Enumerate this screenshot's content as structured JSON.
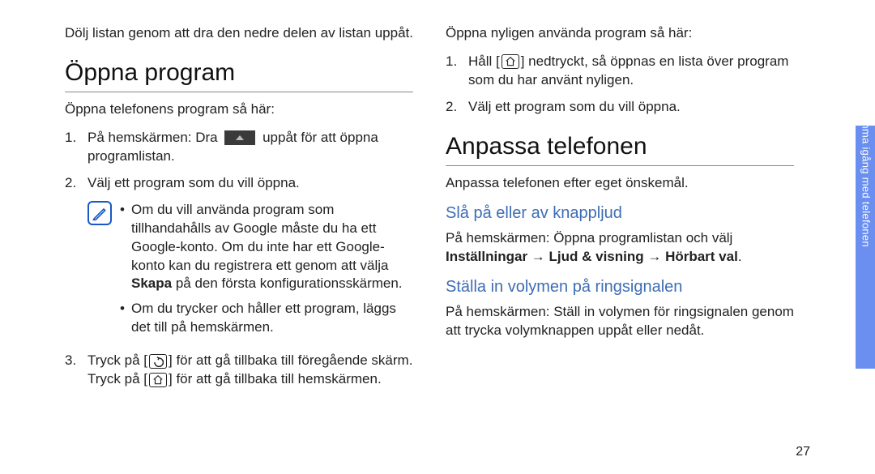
{
  "left": {
    "intro": "Dölj listan genom att dra den nedre delen av listan uppåt.",
    "h1": "Öppna program",
    "sub": "Öppna telefonens program så här:",
    "step1a": "På hemskärmen: Dra ",
    "step1b": " uppåt för att öppna programlistan.",
    "step2": "Välj ett program som du vill öppna.",
    "bullet1a": "Om du vill använda program som tillhandahålls av Google måste du ha ett Google-konto. Om du inte har ett Google-konto kan du registrera ett genom att välja ",
    "bullet1b": "Skapa",
    "bullet1c": " på den första konfigurationsskärmen.",
    "bullet2": "Om du trycker och håller ett program, läggs det till på hemskärmen.",
    "step3a": "Tryck på [",
    "step3b": "] för att gå tillbaka till föregående skärm. Tryck på [",
    "step3c": "] för att gå tillbaka till hemskärmen."
  },
  "right": {
    "intro": "Öppna nyligen använda program så här:",
    "step1a": "Håll [",
    "step1b": "] nedtryckt, så öppnas en lista över program som du har använt nyligen.",
    "step2": "Välj ett program som du vill öppna.",
    "h1": "Anpassa telefonen",
    "sub": "Anpassa telefonen efter eget önskemål.",
    "h2a": "Slå på eller av knappljud",
    "p2a": "På hemskärmen: Öppna programlistan och välj ",
    "p2b": "Inställningar → Ljud & visning → Hörbart val",
    "p2c": ".",
    "h2b": "Ställa in volymen på ringsignalen",
    "p3": "På hemskärmen: Ställ in volymen för ringsignalen genom att trycka volymknappen uppåt eller nedåt."
  },
  "side_label": "Komma igång med telefonen",
  "page_number": "27"
}
